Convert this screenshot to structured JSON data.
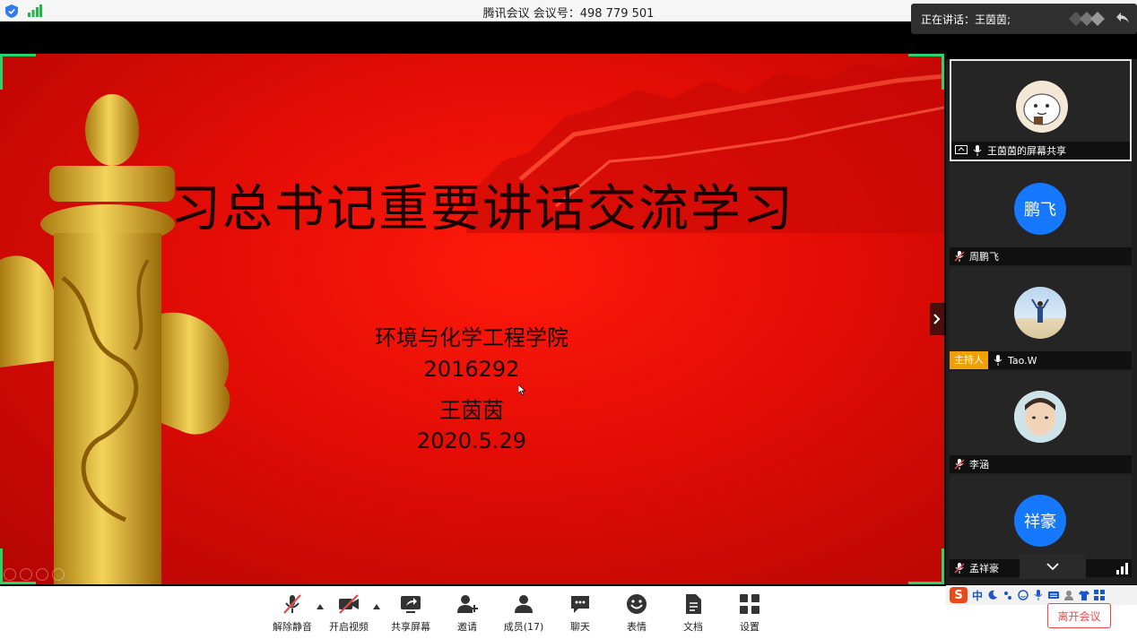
{
  "window": {
    "title": "腾讯会议 会议号：498 779 501"
  },
  "speaking": {
    "text": "正在讲话：王茵茵;"
  },
  "slide": {
    "title": "习总书记重要讲话交流学习",
    "school": "环境与化学工程学院",
    "student_id": "2016292",
    "name": "王茵茵",
    "date": "2020.5.29"
  },
  "participants": [
    {
      "name": "王茵茵的屏幕共享",
      "avatar": "cartoon-avatar",
      "active": true
    },
    {
      "name": "周鹏飞",
      "avatar_text": "鹏飞"
    },
    {
      "name": "Tao.W",
      "badge": "主持人",
      "avatar": "photo-beach"
    },
    {
      "name": "李涵",
      "avatar": "photo-child"
    },
    {
      "name": "孟祥豪",
      "avatar_text": "祥豪"
    }
  ],
  "toolbar": {
    "unmute": "解除静音",
    "video": "开启视频",
    "share": "共享屏幕",
    "invite": "邀请",
    "members": "成员(17)",
    "chat": "聊天",
    "emoji": "表情",
    "docs": "文档",
    "settings": "设置",
    "leave": "离开会议"
  },
  "ime": {
    "logo": "S",
    "lang": "中"
  },
  "colors": {
    "accent_green": "#2bd46a",
    "avatar_blue": "#1677ff",
    "host_orange": "#f0a000",
    "leave_red": "#e94a4a"
  }
}
